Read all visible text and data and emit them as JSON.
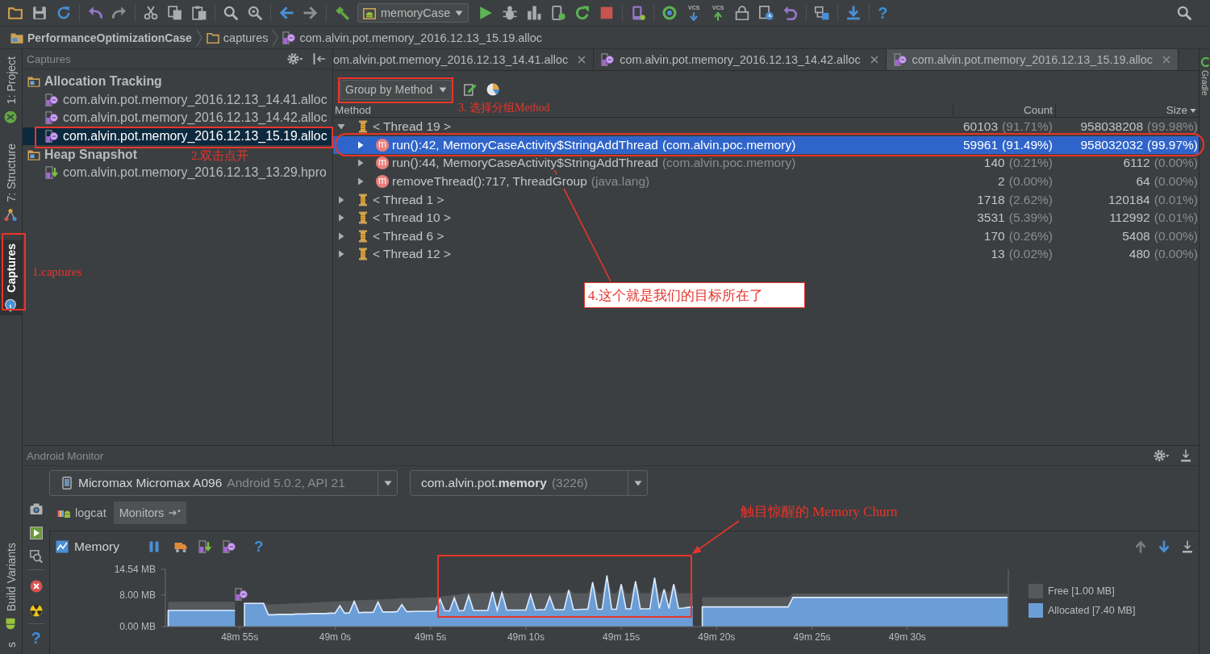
{
  "toolbar": {
    "run_config": "memoryCase",
    "vcs_buttons": [
      {
        "label": "VCS",
        "kind": "update"
      },
      {
        "label": "VCS",
        "kind": "commit"
      }
    ],
    "help": "?"
  },
  "breadcrumb": [
    {
      "label": "PerformanceOptimizationCase",
      "kind": "project"
    },
    {
      "label": "captures",
      "kind": "folder"
    },
    {
      "label": "com.alvin.pot.memory_2016.12.13_15.19.alloc",
      "kind": "alloc"
    }
  ],
  "left_tool_tabs_top": [
    {
      "label": "1: Project",
      "kind": "project",
      "selected": false
    },
    {
      "label": "7: Structure",
      "kind": "structure",
      "selected": false
    },
    {
      "label": "Captures",
      "kind": "captures",
      "selected": true
    }
  ],
  "captures_panel": {
    "title": "Captures",
    "groups": [
      {
        "label": "Allocation Tracking",
        "children": [
          {
            "label": "com.alvin.pot.memory_2016.12.13_14.41.alloc",
            "kind": "alloc",
            "selected": false
          },
          {
            "label": "com.alvin.pot.memory_2016.12.13_14.42.alloc",
            "kind": "alloc",
            "selected": false
          },
          {
            "label": "com.alvin.pot.memory_2016.12.13_15.19.alloc",
            "kind": "alloc",
            "selected": true
          }
        ]
      },
      {
        "label": "Heap Snapshot",
        "children": [
          {
            "label": "com.alvin.pot.memory_2016.12.13_13.29.hpro",
            "kind": "hprof",
            "selected": false
          }
        ]
      }
    ]
  },
  "editor_tabs": [
    {
      "label": "om.alvin.pot.memory_2016.12.13_14.41.alloc",
      "clipped": true,
      "selected": false
    },
    {
      "label": "com.alvin.pot.memory_2016.12.13_14.42.alloc",
      "clipped": false,
      "selected": false
    },
    {
      "label": "com.alvin.pot.memory_2016.12.13_15.19.alloc",
      "clipped": false,
      "selected": true
    }
  ],
  "allocation_view": {
    "group_by": "Group by Method",
    "columns": [
      {
        "label": "Method",
        "sorted": false
      },
      {
        "label": "Count",
        "sorted": false
      },
      {
        "label": "Size",
        "sorted": true
      }
    ],
    "rows": [
      {
        "kind": "thread",
        "label": "< Thread 19 >",
        "expanded": true,
        "selected": false,
        "count": "60103",
        "count_share": "(91.71%)",
        "size": "958038208",
        "size_share": "(99.98%)",
        "children": [
          {
            "kind": "method",
            "badge": "m",
            "label": "run():42, MemoryCaseActivity$StringAddThread",
            "package": "(com.alvin.poc.memory)",
            "expanded": false,
            "selected": true,
            "count": "59961",
            "count_share": "(91.49%)",
            "size": "958032032",
            "size_share": "(99.97%)"
          },
          {
            "kind": "method",
            "badge": "m",
            "label": "run():44, MemoryCaseActivity$StringAddThread",
            "package": "(com.alvin.poc.memory)",
            "expanded": false,
            "selected": false,
            "count": "140",
            "count_share": "(0.21%)",
            "size": "6112",
            "size_share": "(0.00%)"
          },
          {
            "kind": "method",
            "badge": "m",
            "label": "removeThread():717, ThreadGroup",
            "package": "(java.lang)",
            "expanded": false,
            "selected": false,
            "count": "2",
            "count_share": "(0.00%)",
            "size": "64",
            "size_share": "(0.00%)"
          }
        ]
      },
      {
        "kind": "thread",
        "label": "< Thread 1 >",
        "expanded": false,
        "selected": false,
        "count": "1718",
        "count_share": "(2.62%)",
        "size": "120184",
        "size_share": "(0.01%)"
      },
      {
        "kind": "thread",
        "label": "< Thread 10 >",
        "expanded": false,
        "selected": false,
        "count": "3531",
        "count_share": "(5.39%)",
        "size": "112992",
        "size_share": "(0.01%)"
      },
      {
        "kind": "thread",
        "label": "< Thread 6 >",
        "expanded": false,
        "selected": false,
        "count": "170",
        "count_share": "(0.26%)",
        "size": "5408",
        "size_share": "(0.00%)"
      },
      {
        "kind": "thread",
        "label": "< Thread 12 >",
        "expanded": false,
        "selected": false,
        "count": "13",
        "count_share": "(0.02%)",
        "size": "480",
        "size_share": "(0.00%)"
      }
    ]
  },
  "left_tool_tabs_bottom": [
    {
      "label": "Build Variants",
      "kind": "build",
      "selected": false
    },
    {
      "label": "s",
      "kind": "text",
      "selected": false
    }
  ],
  "android_monitor": {
    "title": "Android Monitor",
    "device": {
      "name": "Micromax Micromax A096",
      "detail": "Android 5.0.2, API 21"
    },
    "process": {
      "name": "com.alvin.pot.**memory**",
      "pid": "(3226)"
    },
    "help": "?",
    "tabs": [
      {
        "label": "logcat",
        "kind": "logcat",
        "selected": false
      },
      {
        "label": "Monitors",
        "kind": "monitors",
        "selected": true
      }
    ],
    "memory": {
      "title": "Memory",
      "help": "?",
      "chart_data": {
        "type": "area",
        "stacked": true,
        "legend": "right",
        "categories": [
          null,
          null,
          null,
          null,
          null,
          null,
          null,
          null,
          null,
          null,
          null,
          null,
          null,
          null,
          null,
          "48m 55s",
          null,
          null,
          null,
          null,
          null,
          null,
          null,
          null,
          null,
          null,
          null,
          null,
          null,
          null,
          null,
          null,
          null,
          null,
          null,
          "49m 0s",
          null,
          null,
          null,
          null,
          null,
          null,
          null,
          null,
          null,
          null,
          null,
          null,
          null,
          null,
          null,
          null,
          null,
          null,
          null,
          "49m 5s",
          null,
          null,
          null,
          null,
          null,
          null,
          null,
          null,
          null,
          null,
          null,
          null,
          null,
          null,
          null,
          null,
          null,
          null,
          null,
          "49m 10s",
          null,
          null,
          null,
          null,
          null,
          null,
          null,
          null,
          null,
          null,
          null,
          null,
          null,
          null,
          null,
          null,
          null,
          null,
          null,
          "49m 15s",
          null,
          null,
          null,
          null,
          null,
          null,
          null,
          null,
          null,
          null,
          null,
          null,
          null,
          null,
          null,
          null,
          null,
          null,
          null,
          "49m 20s",
          null,
          null,
          null,
          null,
          null,
          null,
          null,
          null,
          null,
          null,
          null,
          null,
          null,
          null,
          null,
          null,
          null,
          null,
          null,
          "49m 25s",
          null,
          null,
          null,
          null,
          null,
          null,
          null,
          null,
          null,
          null,
          null,
          null,
          null,
          null,
          null,
          null,
          null,
          null,
          null,
          "49m 30s",
          null,
          null,
          null,
          null,
          null,
          null,
          null,
          null,
          null,
          null,
          null,
          null,
          null,
          null,
          null,
          null,
          null,
          null,
          null,
          null,
          null
        ],
        "series": [
          {
            "name": "Allocated [7.40 MB]",
            "color": "#6b9ed6",
            "values": [
              4.1,
              4.1,
              4.1,
              4.1,
              4.1,
              4.1,
              4.1,
              4.1,
              4.1,
              4.1,
              4.1,
              4.1,
              4.1,
              4.1,
              4.1,
              null,
              5.9,
              5.9,
              5.9,
              5.9,
              5.9,
              3.0,
              3.0,
              3.1,
              3.1,
              3.1,
              3.1,
              3.2,
              3.2,
              3.2,
              3.3,
              3.3,
              3.3,
              3.3,
              3.4,
              3.4,
              5.3,
              3.4,
              3.5,
              6.4,
              3.5,
              3.6,
              3.6,
              3.6,
              6.2,
              3.7,
              3.7,
              3.7,
              3.8,
              5.6,
              3.8,
              3.8,
              3.9,
              3.9,
              3.9,
              3.9,
              4.0,
              7.0,
              4.0,
              4.0,
              7.3,
              4.0,
              4.1,
              7.9,
              4.1,
              4.1,
              4.1,
              4.1,
              8.8,
              4.1,
              8.6,
              4.2,
              4.2,
              4.2,
              4.2,
              4.2,
              8.2,
              4.2,
              4.3,
              4.3,
              7.6,
              4.3,
              4.3,
              4.3,
              9.3,
              4.3,
              4.3,
              4.4,
              4.4,
              11.3,
              4.4,
              4.4,
              13.0,
              4.4,
              4.4,
              10.8,
              4.5,
              4.5,
              11.5,
              4.5,
              4.5,
              4.5,
              12.4,
              4.6,
              9.5,
              4.6,
              10.8,
              4.6,
              4.7,
              4.9,
              5.0,
              null,
              5.0,
              5.0,
              5.0,
              5.0,
              5.0,
              5.0,
              5.0,
              5.0,
              5.0,
              5.0,
              5.0,
              5.0,
              5.0,
              5.0,
              5.0,
              5.0,
              5.0,
              5.0,
              5.0,
              7.4,
              7.4,
              7.4,
              7.4,
              7.4,
              7.4,
              7.4,
              7.4,
              7.4,
              7.4,
              7.4,
              7.4,
              7.4,
              7.4,
              7.4,
              7.4,
              7.4,
              7.4,
              7.4,
              7.4,
              7.4,
              7.4,
              7.4,
              7.4,
              7.4,
              7.4,
              7.4,
              7.4,
              7.4,
              7.4,
              7.4,
              7.4,
              7.4,
              7.4,
              7.4,
              7.4,
              7.4,
              7.4,
              7.4,
              7.4,
              7.4,
              7.4,
              7.4,
              7.4,
              7.4,
              7.4
            ]
          },
          {
            "name": "Free [1.00 MB]",
            "color": "#55595c",
            "values": [
              2.2,
              2.2,
              2.2,
              2.2,
              2.2,
              2.2,
              2.2,
              2.2,
              2.2,
              2.2,
              2.2,
              2.2,
              2.2,
              2.2,
              2.2,
              null,
              0.3,
              0.3,
              0.3,
              0.3,
              0.3,
              2.6,
              2.7,
              2.6,
              2.7,
              2.7,
              2.8,
              2.7,
              2.8,
              2.8,
              2.8,
              2.9,
              2.9,
              3.0,
              2.9,
              3.0,
              1.1,
              3.1,
              3.0,
              0.2,
              3.2,
              3.1,
              3.2,
              3.2,
              0.7,
              3.2,
              3.3,
              3.3,
              3.3,
              1.6,
              3.4,
              3.5,
              3.4,
              3.5,
              3.5,
              3.6,
              3.5,
              0.6,
              3.8,
              3.9,
              0.8,
              4.2,
              4.3,
              0.6,
              4.4,
              4.4,
              4.4,
              4.4,
              0,
              4.4,
              0,
              4.3,
              4.3,
              4.3,
              4.3,
              4.3,
              0.3,
              4.3,
              4.2,
              4.2,
              0.9,
              4.2,
              4.2,
              4.2,
              0,
              4.2,
              4.2,
              4.1,
              4.1,
              0,
              4.1,
              4.1,
              0,
              4.1,
              4.1,
              0,
              4.0,
              4.0,
              0,
              4.0,
              4.0,
              4.0,
              0,
              3.9,
              0,
              3.9,
              0,
              3.9,
              3.8,
              3.6,
              3.5,
              null,
              2.5,
              2.5,
              2.5,
              2.5,
              2.5,
              2.5,
              2.5,
              2.5,
              2.5,
              2.5,
              2.5,
              2.5,
              2.5,
              2.5,
              2.5,
              2.5,
              2.5,
              2.5,
              2.5,
              1.0,
              1.0,
              1.0,
              1.0,
              1.0,
              1.0,
              1.0,
              1.0,
              1.0,
              1.0,
              1.0,
              1.0,
              1.0,
              1.0,
              1.0,
              1.0,
              1.0,
              1.0,
              1.0,
              1.0,
              1.0,
              1.0,
              1.0,
              1.0,
              1.0,
              1.0,
              1.0,
              1.0,
              1.0,
              1.0,
              1.0,
              1.0,
              1.0,
              1.0,
              1.0,
              1.0,
              1.0,
              1.0,
              1.0,
              1.0,
              1.0,
              1.0,
              1.0,
              1.0,
              1.0,
              1.0
            ]
          }
        ],
        "ylim": [
          0,
          14.54
        ],
        "yticks": [
          {
            "value": 0,
            "label": "0.00 MB"
          },
          {
            "value": 8,
            "label": "8.00 MB"
          },
          {
            "value": 14.54,
            "label": "14.54 MB"
          }
        ]
      }
    }
  },
  "right_tool_tabs": [
    {
      "label": "Gradle",
      "kind": "gradle",
      "selected": false
    }
  ],
  "annotations": [
    {
      "kind": "note",
      "text": "1.captures"
    },
    {
      "kind": "note",
      "text": "2.双击点开"
    },
    {
      "kind": "note",
      "text": "3. 选择分组Method"
    },
    {
      "kind": "callout",
      "text": "4.这个就是我们的目标所在了"
    },
    {
      "kind": "note",
      "text": "触目惊醒的 Memory Churn"
    }
  ]
}
